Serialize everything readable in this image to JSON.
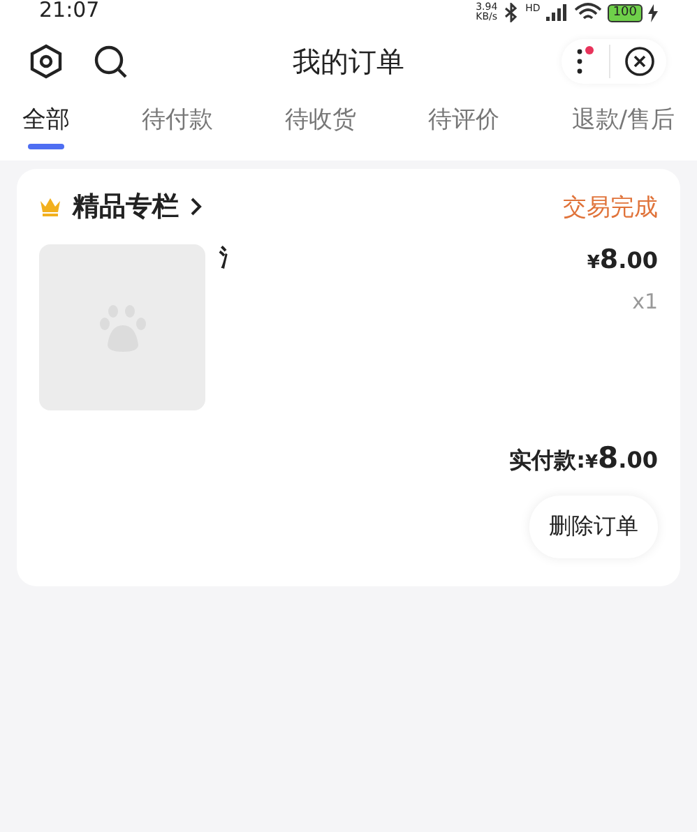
{
  "status_bar": {
    "time": "21:07",
    "speed_value": "3.94",
    "speed_unit": "KB/s",
    "network": "HD",
    "battery": "100",
    "charging": true
  },
  "header": {
    "title": "我的订单",
    "notification_dot": true
  },
  "tabs": [
    {
      "label": "全部",
      "selected": true
    },
    {
      "label": "待付款",
      "selected": false
    },
    {
      "label": "待收货",
      "selected": false
    },
    {
      "label": "待评价",
      "selected": false
    },
    {
      "label": "退款/售后",
      "selected": false
    }
  ],
  "orders": [
    {
      "shop": "精品专栏",
      "status": "交易完成",
      "item_title": "氵",
      "price": {
        "currency": "¥",
        "integer": "8",
        "decimal": ".00"
      },
      "quantity": "x1",
      "paid_label": "实付款:",
      "paid": {
        "currency": "¥",
        "integer": "8",
        "decimal": ".00"
      },
      "action": "删除订单"
    }
  ]
}
